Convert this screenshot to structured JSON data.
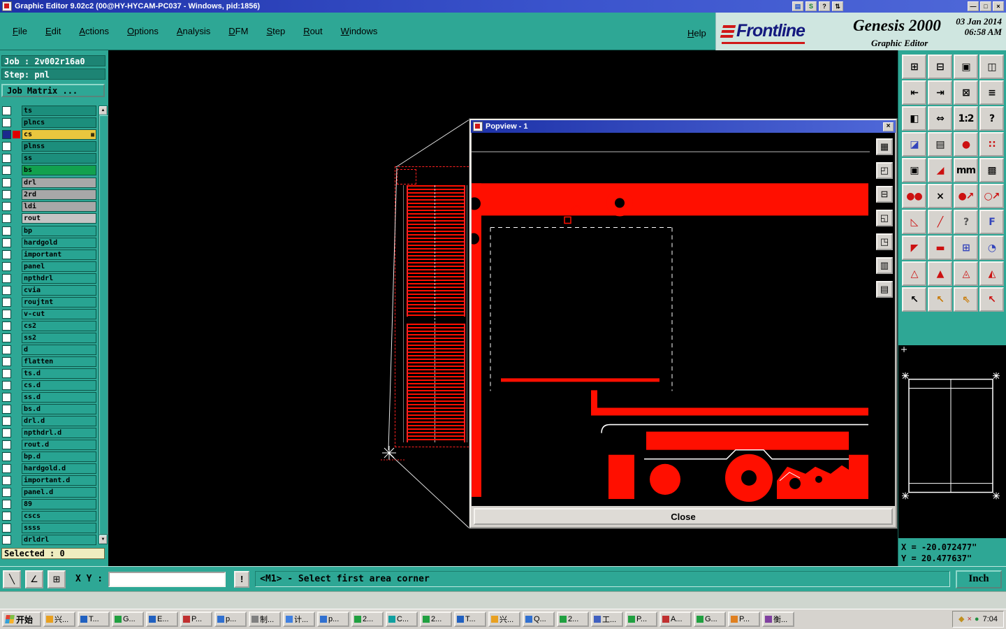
{
  "titlebar": {
    "title": "Graphic Editor 9.02c2 (00@HY-HYCAM-PC037 - Windows, pid:1856)",
    "mini_buttons": [
      {
        "name": "panel-button",
        "glyph": "▤",
        "color": "#2255cc"
      },
      {
        "name": "session-button",
        "glyph": "S",
        "color": "#108030"
      },
      {
        "name": "help-button",
        "glyph": "?",
        "color": "#000000"
      },
      {
        "name": "spinner-button",
        "glyph": "⇅",
        "color": "#000000"
      }
    ],
    "window_buttons": [
      {
        "name": "minimize-button",
        "glyph": "—"
      },
      {
        "name": "maximize-button",
        "glyph": "□"
      },
      {
        "name": "close-button",
        "glyph": "×"
      }
    ]
  },
  "menubar": {
    "items": [
      {
        "label": "File"
      },
      {
        "label": "Edit"
      },
      {
        "label": "Actions"
      },
      {
        "label": "Options"
      },
      {
        "label": "Analysis"
      },
      {
        "label": "DFM"
      },
      {
        "label": "Step"
      },
      {
        "label": "Rout"
      },
      {
        "label": "Windows"
      }
    ],
    "help": "Help"
  },
  "branding": {
    "logo": "Frontline",
    "product": "Genesis 2000",
    "date": "03 Jan 2014",
    "time": "06:58 AM",
    "app": "Graphic Editor"
  },
  "sidebar": {
    "job_label": "Job : 2v002r16a0",
    "step_label": "Step: pnl",
    "job_matrix_button": "Job Matrix ...",
    "selected_label": "Selected : 0",
    "layers": [
      {
        "name": "ts",
        "color": "#1c8e7c",
        "box": "#ffffff",
        "slot": "transparent",
        "badge": ""
      },
      {
        "name": "plncs",
        "color": "#1c8e7c",
        "box": "#ffffff",
        "slot": "transparent",
        "badge": ""
      },
      {
        "name": "cs",
        "color": "#e9c63e",
        "box": "#1b2a8c",
        "slot": "#e00000",
        "badge": "▦"
      },
      {
        "name": "plnss",
        "color": "#1c8e7c",
        "box": "#ffffff",
        "slot": "transparent",
        "badge": ""
      },
      {
        "name": "ss",
        "color": "#1c8e7c",
        "box": "#ffffff",
        "slot": "transparent",
        "badge": ""
      },
      {
        "name": "bs",
        "color": "#12a14e",
        "box": "#ffffff",
        "slot": "transparent",
        "badge": ""
      },
      {
        "name": "drl",
        "color": "#a8a8a8",
        "box": "#ffffff",
        "slot": "transparent",
        "badge": "",
        "mt": "3px"
      },
      {
        "name": "2rd",
        "color": "#a8a8a8",
        "box": "#ffffff",
        "slot": "transparent",
        "badge": ""
      },
      {
        "name": "ldi",
        "color": "#a8a8a8",
        "box": "#ffffff",
        "slot": "transparent",
        "badge": ""
      },
      {
        "name": "rout",
        "color": "#c4c4c4",
        "box": "#ffffff",
        "slot": "transparent",
        "badge": ""
      },
      {
        "name": "bp",
        "color": "#28a492",
        "box": "#ffffff",
        "slot": "transparent",
        "badge": "",
        "mt": "3px"
      },
      {
        "name": "hardgold",
        "color": "#28a492",
        "box": "#ffffff",
        "slot": "transparent",
        "badge": ""
      },
      {
        "name": "important",
        "color": "#28a492",
        "box": "#ffffff",
        "slot": "transparent",
        "badge": ""
      },
      {
        "name": "panel",
        "color": "#28a492",
        "box": "#ffffff",
        "slot": "transparent",
        "badge": ""
      },
      {
        "name": "npthdrl",
        "color": "#28a492",
        "box": "#ffffff",
        "slot": "transparent",
        "badge": ""
      },
      {
        "name": "cvia",
        "color": "#28a492",
        "box": "#ffffff",
        "slot": "transparent",
        "badge": ""
      },
      {
        "name": "roujtnt",
        "color": "#28a492",
        "box": "#ffffff",
        "slot": "transparent",
        "badge": ""
      },
      {
        "name": "v-cut",
        "color": "#28a492",
        "box": "#ffffff",
        "slot": "transparent",
        "badge": ""
      },
      {
        "name": "cs2",
        "color": "#28a492",
        "box": "#ffffff",
        "slot": "transparent",
        "badge": ""
      },
      {
        "name": "ss2",
        "color": "#28a492",
        "box": "#ffffff",
        "slot": "transparent",
        "badge": ""
      },
      {
        "name": "d",
        "color": "#28a492",
        "box": "#ffffff",
        "slot": "transparent",
        "badge": ""
      },
      {
        "name": "flatten",
        "color": "#28a492",
        "box": "#ffffff",
        "slot": "transparent",
        "badge": ""
      },
      {
        "name": "ts.d",
        "color": "#28a492",
        "box": "#ffffff",
        "slot": "transparent",
        "badge": ""
      },
      {
        "name": "cs.d",
        "color": "#28a492",
        "box": "#ffffff",
        "slot": "transparent",
        "badge": ""
      },
      {
        "name": "ss.d",
        "color": "#28a492",
        "box": "#ffffff",
        "slot": "transparent",
        "badge": ""
      },
      {
        "name": "bs.d",
        "color": "#28a492",
        "box": "#ffffff",
        "slot": "transparent",
        "badge": ""
      },
      {
        "name": "drl.d",
        "color": "#28a492",
        "box": "#ffffff",
        "slot": "transparent",
        "badge": ""
      },
      {
        "name": "npthdrl.d",
        "color": "#28a492",
        "box": "#ffffff",
        "slot": "transparent",
        "badge": ""
      },
      {
        "name": "rout.d",
        "color": "#28a492",
        "box": "#ffffff",
        "slot": "transparent",
        "badge": ""
      },
      {
        "name": "bp.d",
        "color": "#28a492",
        "box": "#ffffff",
        "slot": "transparent",
        "badge": ""
      },
      {
        "name": "hardgold.d",
        "color": "#28a492",
        "box": "#ffffff",
        "slot": "transparent",
        "badge": ""
      },
      {
        "name": "important.d",
        "color": "#28a492",
        "box": "#ffffff",
        "slot": "transparent",
        "badge": ""
      },
      {
        "name": "panel.d",
        "color": "#28a492",
        "box": "#ffffff",
        "slot": "transparent",
        "badge": ""
      },
      {
        "name": "89",
        "color": "#28a492",
        "box": "#ffffff",
        "slot": "transparent",
        "badge": ""
      },
      {
        "name": "cscs",
        "color": "#28a492",
        "box": "#ffffff",
        "slot": "transparent",
        "badge": ""
      },
      {
        "name": "ssss",
        "color": "#28a492",
        "box": "#ffffff",
        "slot": "transparent",
        "badge": ""
      },
      {
        "name": "drldrl",
        "color": "#28a492",
        "box": "#ffffff",
        "slot": "transparent",
        "badge": ""
      }
    ]
  },
  "popview": {
    "title": "Popview - 1",
    "close_x": "×",
    "close_button": "Close",
    "tools": [
      {
        "name": "matrix-view-icon",
        "glyph": "▦"
      },
      {
        "name": "page-up-icon",
        "glyph": "◰"
      },
      {
        "name": "screen-fit-icon",
        "glyph": "⊟"
      },
      {
        "name": "page-view-icon",
        "glyph": "◱"
      },
      {
        "name": "pan-view-icon",
        "glyph": "◳"
      },
      {
        "name": "grid-view-icon",
        "glyph": "▥"
      },
      {
        "name": "layers-view-icon",
        "glyph": "▤"
      }
    ]
  },
  "right_toolbar": {
    "buttons": [
      {
        "name": "new-page-icon",
        "glyph": "⊞",
        "color": "#000000"
      },
      {
        "name": "screen-icon",
        "glyph": "⊟",
        "color": "#000000"
      },
      {
        "name": "window-icon",
        "glyph": "▣",
        "color": "#000000"
      },
      {
        "name": "split-window-icon",
        "glyph": "◫",
        "color": "#000000"
      },
      {
        "name": "exit-left-icon",
        "glyph": "⇤",
        "color": "#000000"
      },
      {
        "name": "exit-right-icon",
        "glyph": "⇥",
        "color": "#000000"
      },
      {
        "name": "board-icon",
        "glyph": "⊠",
        "color": "#000000"
      },
      {
        "name": "lines-icon",
        "glyph": "≡",
        "color": "#000000"
      },
      {
        "name": "halfscreen-icon",
        "glyph": "◧",
        "color": "#000000"
      },
      {
        "name": "swap-view-icon",
        "glyph": "⇔",
        "color": "#000000"
      },
      {
        "name": "ratio-1-2-icon",
        "glyph": "1:2",
        "color": "#000000"
      },
      {
        "name": "help-tool-icon",
        "glyph": "?",
        "color": "#000000"
      },
      {
        "name": "overlay-icon",
        "glyph": "◪",
        "color": "#3344bb"
      },
      {
        "name": "cascade-icon",
        "glyph": "▤",
        "color": "#000000"
      },
      {
        "name": "probe-icon",
        "glyph": "●",
        "color": "#cc1111"
      },
      {
        "name": "dot-matrix-icon",
        "glyph": "∷",
        "color": "#cc1111"
      },
      {
        "name": "frame-icon",
        "glyph": "▣",
        "color": "#000000"
      },
      {
        "name": "corner-icon",
        "glyph": "◢",
        "color": "#cc1111"
      },
      {
        "name": "ruler-mm-icon",
        "glyph": "mm",
        "color": "#000000"
      },
      {
        "name": "hatch-pad-icon",
        "glyph": "▩",
        "color": "#000000"
      },
      {
        "name": "two-circles-icon",
        "glyph": "●●",
        "color": "#cc1111"
      },
      {
        "name": "delete-x-icon",
        "glyph": "×",
        "color": "#000000"
      },
      {
        "name": "vertex-arrow-icon",
        "glyph": "●↗",
        "color": "#cc1111"
      },
      {
        "name": "vertex-arrow2-icon",
        "glyph": "○↗",
        "color": "#cc1111"
      },
      {
        "name": "wedge-icon",
        "glyph": "◺",
        "color": "#cc1111"
      },
      {
        "name": "slash-icon",
        "glyph": "╱",
        "color": "#cc1111"
      },
      {
        "name": "query-icon",
        "glyph": "?",
        "color": "#555555"
      },
      {
        "name": "mirror-f-icon",
        "glyph": "F",
        "color": "#3344bb"
      },
      {
        "name": "shape-icon",
        "glyph": "◤",
        "color": "#cc1111"
      },
      {
        "name": "dash-icon",
        "glyph": "▬",
        "color": "#cc1111"
      },
      {
        "name": "plus-box-icon",
        "glyph": "⊞",
        "color": "#3344bb"
      },
      {
        "name": "pie-icon",
        "glyph": "◔",
        "color": "#3344bb"
      },
      {
        "name": "triangle-outline-icon",
        "glyph": "△",
        "color": "#cc1111"
      },
      {
        "name": "triangle-filled-icon",
        "glyph": "▲",
        "color": "#cc1111"
      },
      {
        "name": "triangle-dot-icon",
        "glyph": "◬",
        "color": "#cc1111"
      },
      {
        "name": "triangle-half-icon",
        "glyph": "◭",
        "color": "#cc1111"
      },
      {
        "name": "cursor-select-icon",
        "glyph": "↖",
        "color": "#000000"
      },
      {
        "name": "cursor-add-icon",
        "glyph": "↖",
        "color": "#c87800"
      },
      {
        "name": "cursor-pick-icon",
        "glyph": "⇖",
        "color": "#c87800"
      },
      {
        "name": "cursor-mark-icon",
        "glyph": "↖",
        "color": "#cc1111"
      }
    ]
  },
  "coords": {
    "x": "X = -20.072477\"",
    "y": "Y = 20.477637\""
  },
  "command_bar": {
    "snap_buttons": [
      {
        "name": "line-mode-button",
        "glyph": "╲"
      },
      {
        "name": "angle-mode-button",
        "glyph": "∠"
      },
      {
        "name": "grid-mode-button",
        "glyph": "⊞"
      }
    ],
    "xy_label": "X Y :",
    "input_value": "",
    "alert": "!",
    "status": "<M1> - Select first area corner",
    "unit_button": "Inch"
  },
  "taskbar": {
    "start": "开始",
    "items": [
      {
        "label": "兴...",
        "color": "#e8a020"
      },
      {
        "label": "T...",
        "color": "#2060c0"
      },
      {
        "label": "G...",
        "color": "#20a040"
      },
      {
        "label": "E...",
        "color": "#2060c0"
      },
      {
        "label": "P...",
        "color": "#c03030"
      },
      {
        "label": "p...",
        "color": "#3070d0"
      },
      {
        "label": "制...",
        "color": "#808080"
      },
      {
        "label": "计...",
        "color": "#4080e0"
      },
      {
        "label": "p...",
        "color": "#3070d0"
      },
      {
        "label": "2...",
        "color": "#20a040"
      },
      {
        "label": "C...",
        "color": "#10a0a0"
      },
      {
        "label": "2...",
        "color": "#20a040"
      },
      {
        "label": "T...",
        "color": "#2060c0"
      },
      {
        "label": "兴...",
        "color": "#e8a020"
      },
      {
        "label": "Q...",
        "color": "#3070d0"
      },
      {
        "label": "2...",
        "color": "#20a040"
      },
      {
        "label": "工...",
        "color": "#4060c0"
      },
      {
        "label": "P...",
        "color": "#20a040"
      },
      {
        "label": "A...",
        "color": "#c03030"
      },
      {
        "label": "G...",
        "color": "#20a040"
      },
      {
        "label": "P...",
        "color": "#e08020"
      },
      {
        "label": "衡...",
        "color": "#8040a0"
      }
    ],
    "tray": {
      "icons": [
        {
          "name": "key-tray-icon",
          "glyph": "◆",
          "color": "#c09020"
        },
        {
          "name": "alert-tray-icon",
          "glyph": "×",
          "color": "#c03030"
        },
        {
          "name": "shield-tray-icon",
          "glyph": "●",
          "color": "#209040"
        }
      ],
      "time": "7:04"
    }
  }
}
